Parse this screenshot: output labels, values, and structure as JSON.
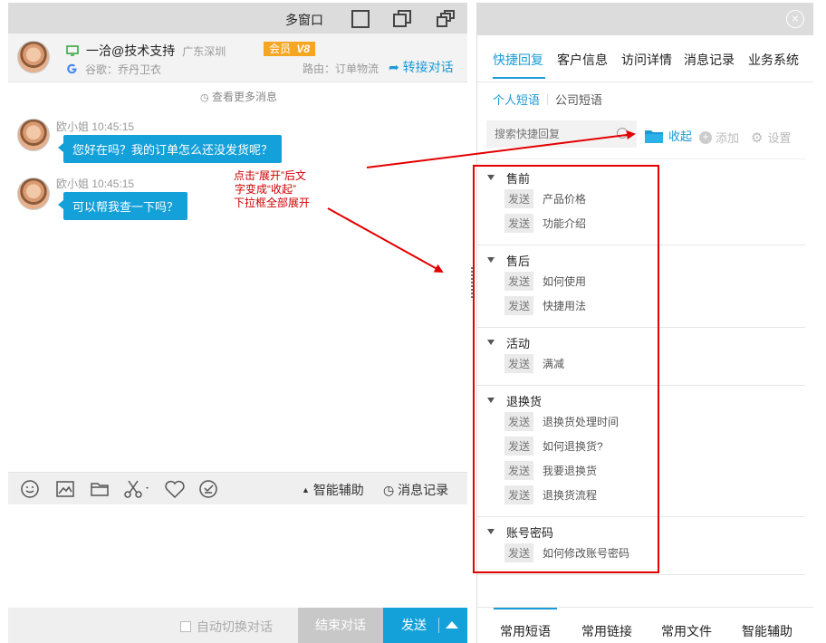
{
  "left_window": {
    "title": "多窗口",
    "contact": {
      "name": "一洽@技术支持",
      "location": "广东深圳",
      "vip_label": "会员",
      "vip_level": "V8",
      "browser": "谷歌：乔丹卫衣",
      "route": "路由：订单物流",
      "transfer_label": "转接对话"
    },
    "load_more": "查看更多消息",
    "messages": [
      {
        "sender": "欧小姐",
        "time": "10:45:15",
        "text": "您好在吗？我的订单怎么还没发货呢？"
      },
      {
        "sender": "欧小姐",
        "time": "10:45:15",
        "text": "可以帮我查一下吗？"
      }
    ],
    "annotation": [
      "点击“展开”后文",
      "字变成“收起”",
      "下拉框全部展开"
    ],
    "toolbar": {
      "icons": [
        "emoji-icon",
        "image-icon",
        "folder-icon",
        "scissors-icon",
        "heart-icon",
        "rating-icon"
      ],
      "assist_label": "智能辅助",
      "history_label": "消息记录"
    },
    "bottom": {
      "auto_switch_label": "自动切换对话",
      "end_label": "结束对话",
      "send_label": "发送"
    }
  },
  "right_panel": {
    "tabs": [
      "快捷回复",
      "客户信息",
      "访问详情",
      "消息记录",
      "业务系统"
    ],
    "active_tab": 0,
    "subtabs": [
      "个人短语",
      "公司短语"
    ],
    "search_placeholder": "搜索快捷回复",
    "collapse_label": "收起",
    "add_label": "添加",
    "settings_label": "设置",
    "send_tag": "发送",
    "groups": [
      {
        "title": "售前",
        "items": [
          "产品价格",
          "功能介绍"
        ]
      },
      {
        "title": "售后",
        "items": [
          "如何使用",
          "快捷用法"
        ]
      },
      {
        "title": "活动",
        "items": [
          "满减"
        ]
      },
      {
        "title": "退换货",
        "items": [
          "退换货处理时间",
          "如何退换货?",
          "我要退换货",
          "退换货流程"
        ]
      },
      {
        "title": "账号密码",
        "items": [
          "如何修改账号密码"
        ]
      }
    ],
    "bottom_tabs": [
      "常用短语",
      "常用链接",
      "常用文件",
      "智能辅助"
    ]
  },
  "colors": {
    "accent": "#1a9ad6",
    "bubble": "#14a0d8",
    "vip": "#f5a623",
    "annotation_red": "#e30000"
  }
}
